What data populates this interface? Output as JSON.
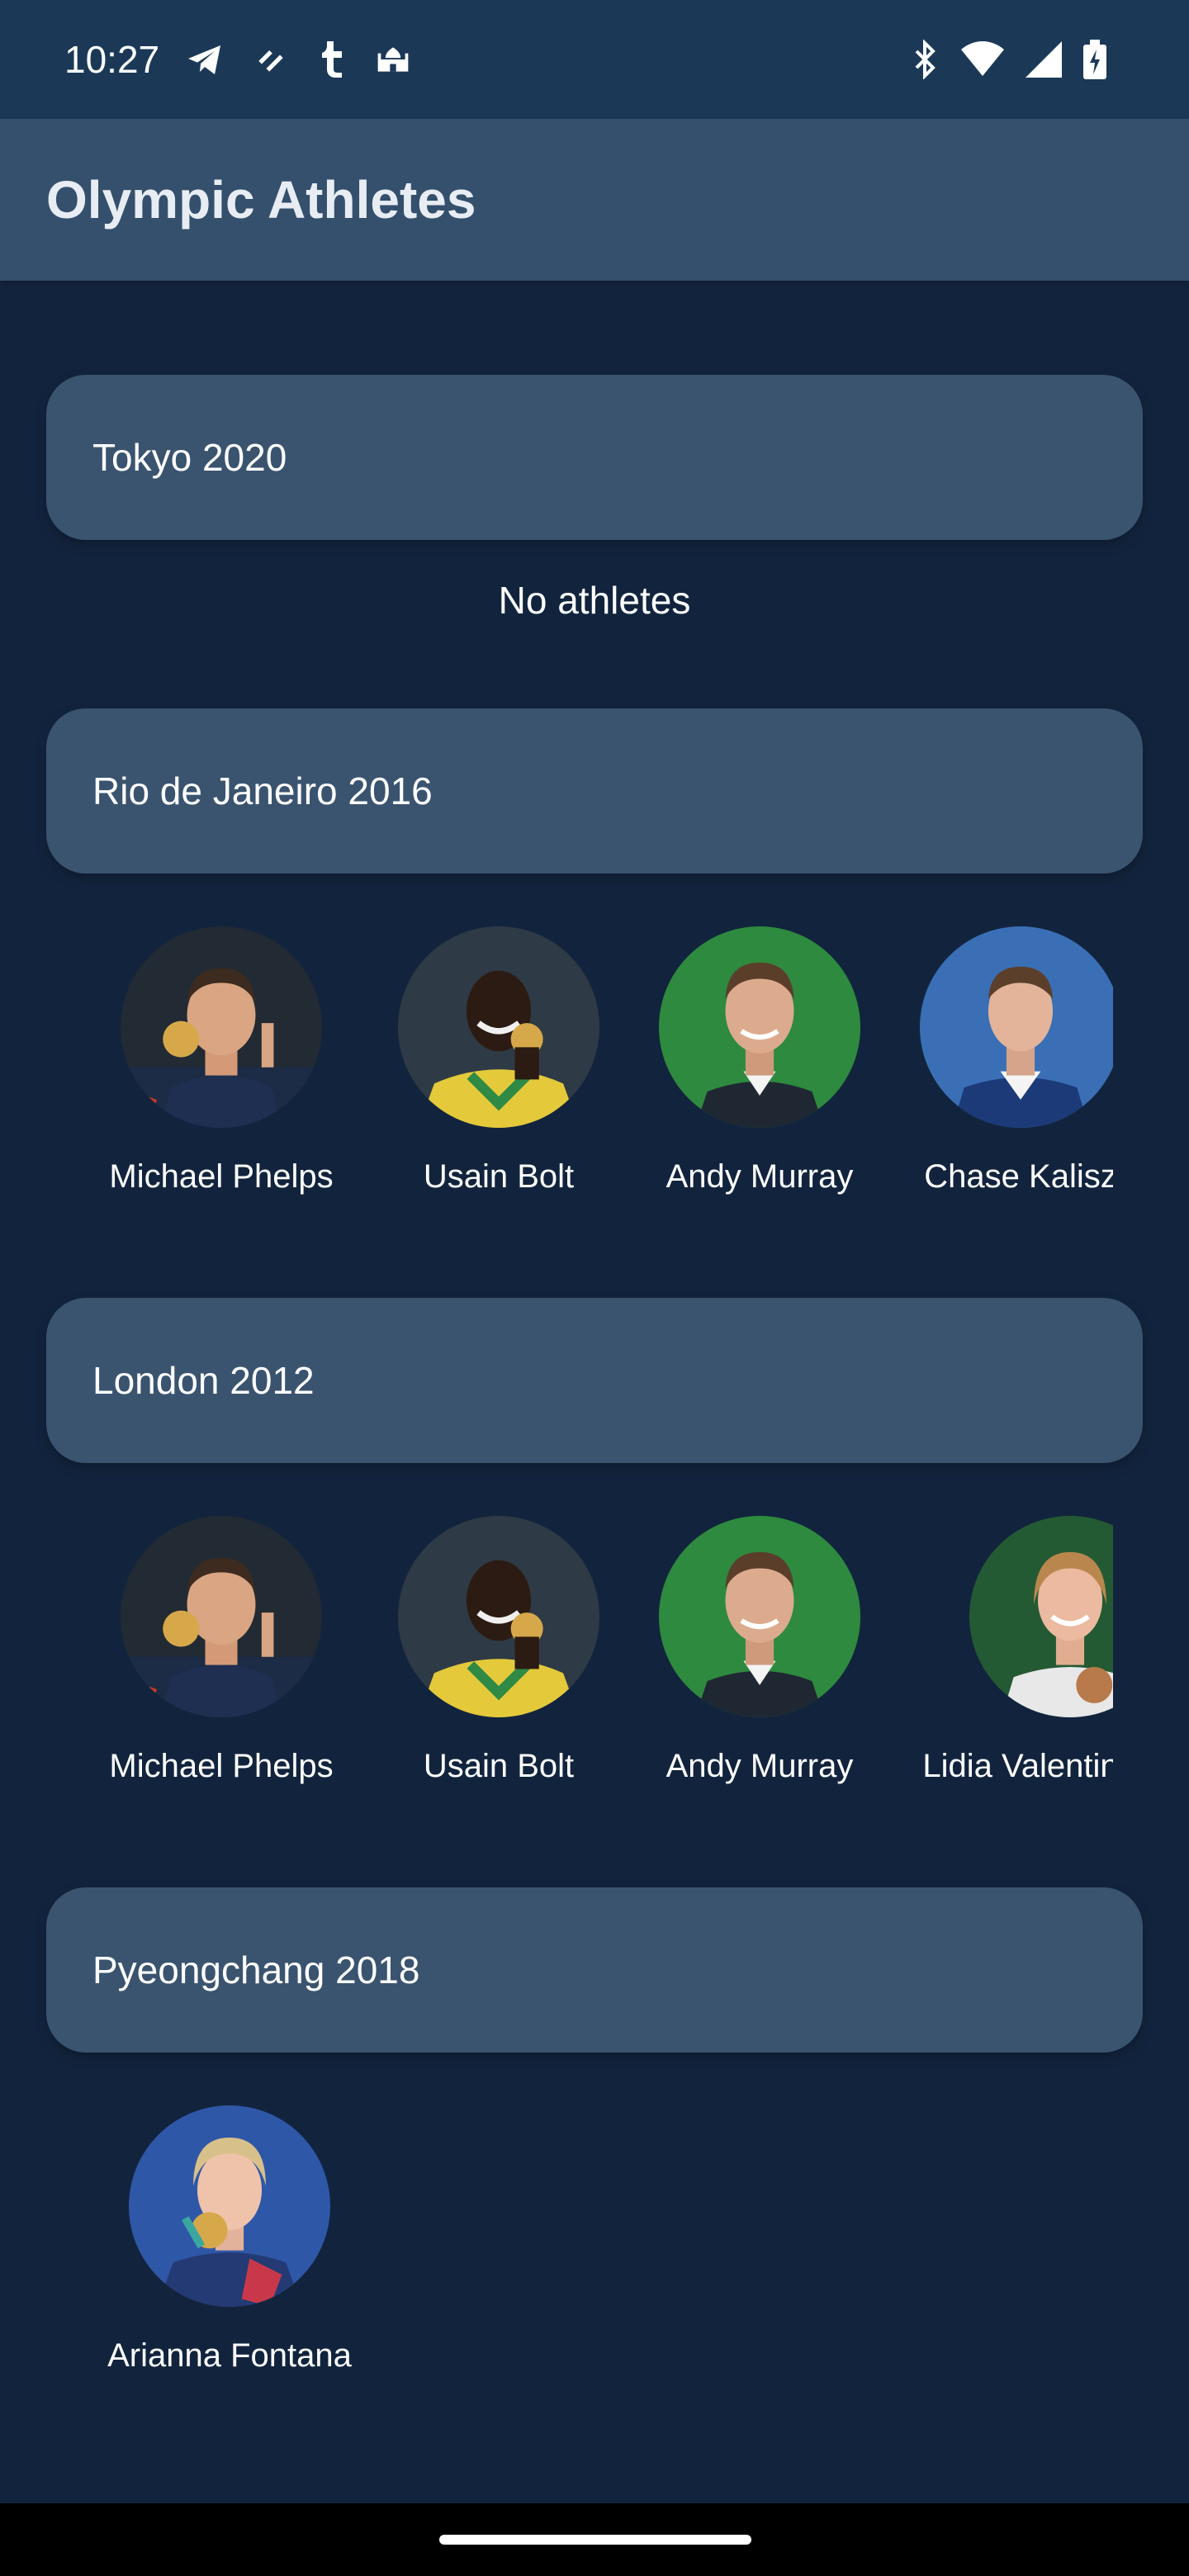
{
  "status_bar": {
    "time": "10:27",
    "left_icons": [
      "telegram-icon",
      "app-notification-icon",
      "tumblr-icon",
      "mosque-icon"
    ],
    "right_icons": [
      "bluetooth-icon",
      "wifi-icon",
      "cellular-signal-icon",
      "battery-charging-icon"
    ]
  },
  "app_bar": {
    "title": "Olympic Athletes"
  },
  "games": [
    {
      "title": "Tokyo 2020",
      "empty_text": "No athletes",
      "athletes": []
    },
    {
      "title": "Rio de Janeiro 2016",
      "athletes": [
        {
          "name": "Michael Phelps"
        },
        {
          "name": "Usain Bolt"
        },
        {
          "name": "Andy Murray"
        },
        {
          "name": "Chase Kalisz"
        }
      ]
    },
    {
      "title": "London 2012",
      "athletes": [
        {
          "name": "Michael Phelps"
        },
        {
          "name": "Usain Bolt"
        },
        {
          "name": "Andy Murray"
        },
        {
          "name": "Lidia Valentin"
        }
      ]
    },
    {
      "title": "Pyeongchang 2018",
      "athletes": [
        {
          "name": "Arianna Fontana"
        }
      ]
    }
  ],
  "colors": {
    "background": "#12243d",
    "status_bar": "#1b3957",
    "app_bar": "#35506d",
    "card": "#3a546f"
  }
}
